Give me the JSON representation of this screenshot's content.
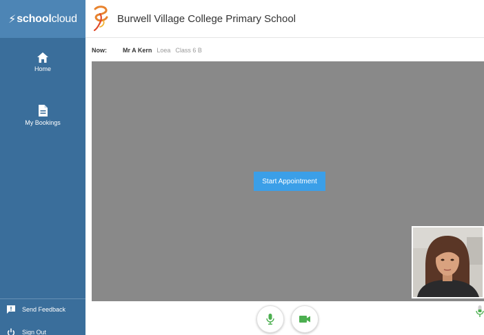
{
  "brand": {
    "bolt": "⚡",
    "name_bold": "school",
    "name_light": "cloud"
  },
  "sidebar": {
    "items": [
      {
        "label": "Home",
        "icon": "home-icon"
      },
      {
        "label": "My Bookings",
        "icon": "document-icon"
      }
    ],
    "footer": [
      {
        "label": "Send Feedback",
        "icon": "feedback-icon"
      },
      {
        "label": "Sign Out",
        "icon": "power-icon"
      }
    ]
  },
  "header": {
    "school_name": "Burwell Village College Primary School",
    "logo_icon": "school-crest-icon"
  },
  "now_bar": {
    "label": "Now:",
    "teacher": "Mr A Kern",
    "room": "Loea",
    "class": "Class 6 B"
  },
  "video": {
    "start_button": "Start Appointment"
  },
  "controls": {
    "mic_icon": "microphone-icon",
    "camera_icon": "video-camera-icon",
    "mic_level_icon": "microphone-level-icon"
  },
  "colors": {
    "sidebar": "#3a6e9b",
    "brand_bar": "#4d85b5",
    "accent_blue": "#3b9fe8",
    "video_bg": "#898989",
    "control_green": "#4caf50"
  }
}
